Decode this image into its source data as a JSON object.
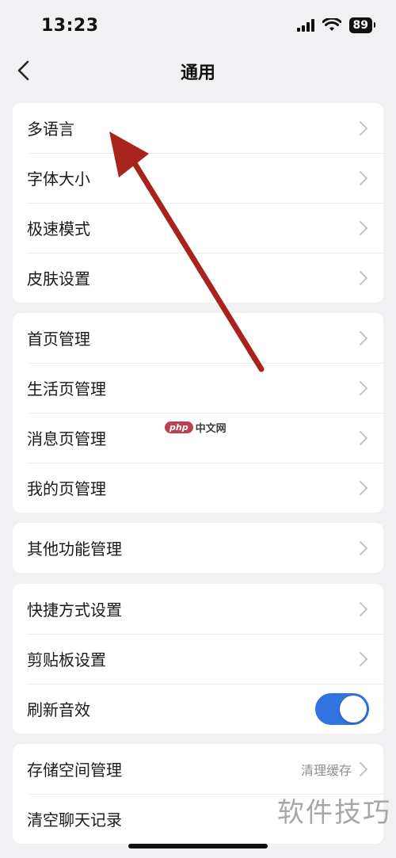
{
  "status": {
    "time": "13:23",
    "battery": "89"
  },
  "nav": {
    "title": "通用",
    "back_icon": "chevron-left-icon"
  },
  "groups": [
    {
      "items": [
        {
          "label": "多语言"
        },
        {
          "label": "字体大小"
        },
        {
          "label": "极速模式"
        },
        {
          "label": "皮肤设置"
        }
      ]
    },
    {
      "items": [
        {
          "label": "首页管理"
        },
        {
          "label": "生活页管理"
        },
        {
          "label": "消息页管理"
        },
        {
          "label": "我的页管理"
        }
      ]
    },
    {
      "items": [
        {
          "label": "其他功能管理"
        }
      ]
    },
    {
      "items": [
        {
          "label": "快捷方式设置"
        },
        {
          "label": "剪贴板设置"
        },
        {
          "label": "刷新音效",
          "toggle_on": true
        }
      ]
    },
    {
      "items": [
        {
          "label": "存储空间管理",
          "value": "清理缓存"
        },
        {
          "label": "清空聊天记录"
        }
      ]
    }
  ],
  "watermark": {
    "logo_php": "php",
    "logo_cn": "中文网",
    "text": "软件技巧"
  },
  "colors": {
    "toggle_accent": "#3173e0",
    "annotation_arrow": "#a8231c",
    "background": "#f1f1f3"
  }
}
